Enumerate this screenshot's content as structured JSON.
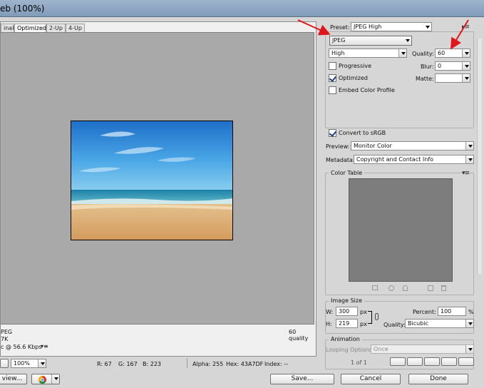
{
  "window": {
    "title": "eb (100%)"
  },
  "tabs": [
    {
      "label": "inal",
      "active": false
    },
    {
      "label": "Optimized",
      "active": true
    },
    {
      "label": "2-Up",
      "active": false
    },
    {
      "label": "4-Up",
      "active": false
    }
  ],
  "image_info": {
    "format": "PEG",
    "size": "7K",
    "speed": "c @ 56.6 Kbps",
    "speed_menu": "▾≡",
    "quality_note": "60 quality"
  },
  "statusbar": {
    "zoom": "100%",
    "r": "R: 67",
    "g": "G: 167",
    "b": "B: 223",
    "alpha": "Alpha: 255",
    "hex": "Hex: 43A7DF",
    "index": "Index: --"
  },
  "settings": {
    "preset_label": "Preset:",
    "preset_value": "JPEG High",
    "format_value": "JPEG",
    "quality_level": "High",
    "quality_label": "Quality:",
    "quality_value": "60",
    "progressive_label": "Progressive",
    "progressive_checked": false,
    "blur_label": "Blur:",
    "blur_value": "0",
    "optimized_label": "Optimized",
    "optimized_checked": true,
    "matte_label": "Matte:",
    "embed_profile_label": "Embed Color Profile",
    "embed_profile_checked": false,
    "convert_srgb_label": "Convert to sRGB",
    "convert_srgb_checked": true,
    "preview_label": "Preview:",
    "preview_value": "Monitor Color",
    "metadata_label": "Metadata:",
    "metadata_value": "Copyright and Contact Info"
  },
  "color_table": {
    "title": "Color Table"
  },
  "image_size": {
    "title": "Image Size",
    "w_label": "W:",
    "w_value": "300",
    "h_label": "H:",
    "h_value": "219",
    "unit": "px",
    "percent_label": "Percent:",
    "percent_value": "100",
    "percent_unit": "%",
    "quality_label": "Quality:",
    "quality_value": "Bicubic"
  },
  "animation": {
    "title": "Animation",
    "looping_label": "Looping Options:",
    "looping_value": "Once",
    "frame": "1 of 1"
  },
  "buttons": {
    "preview": "view...",
    "save": "Save...",
    "cancel": "Cancel",
    "done": "Done"
  },
  "colors": {
    "annotation_arrow": "#e0161b",
    "canvas_bg": "#a9a9a9",
    "color_table_bg": "#7d7d7d"
  }
}
